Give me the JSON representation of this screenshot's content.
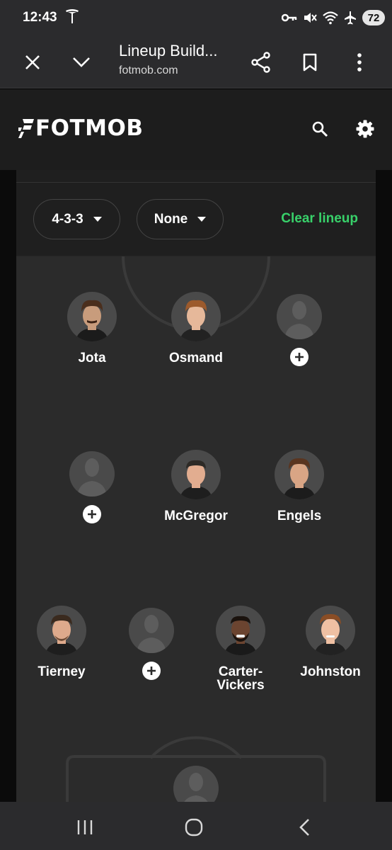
{
  "status_bar": {
    "time": "12:43",
    "battery": "72",
    "icons": [
      "tesla-icon",
      "key-icon",
      "mute-icon",
      "wifi-icon",
      "airplane-icon"
    ]
  },
  "browser": {
    "page_title": "Lineup Build...",
    "url": "fotmob.com",
    "icons": [
      "close-icon",
      "chevron-down-icon",
      "share-icon",
      "bookmark-icon",
      "more-vert-icon"
    ]
  },
  "header": {
    "logo_text": "FOTMOB",
    "icons": [
      "search-icon",
      "gear-icon"
    ]
  },
  "controls": {
    "formation": "4-3-3",
    "team_filter": "None",
    "clear_label": "Clear lineup",
    "accent_color": "#38d16a"
  },
  "lineup": {
    "forwards": [
      {
        "name": "Jota",
        "filled": true
      },
      {
        "name": "Osmand",
        "filled": true
      },
      {
        "name": "",
        "filled": false
      }
    ],
    "midfielders": [
      {
        "name": "",
        "filled": false
      },
      {
        "name": "McGregor",
        "filled": true
      },
      {
        "name": "Engels",
        "filled": true
      }
    ],
    "defenders": [
      {
        "name": "Tierney",
        "filled": true
      },
      {
        "name": "",
        "filled": false
      },
      {
        "name": "Carter-Vickers",
        "filled": true
      },
      {
        "name": "Johnston",
        "filled": true
      }
    ],
    "goalkeeper": {
      "name": "",
      "filled": false
    }
  },
  "nav": {
    "icons": [
      "recent-apps-icon",
      "home-icon",
      "back-icon"
    ]
  }
}
